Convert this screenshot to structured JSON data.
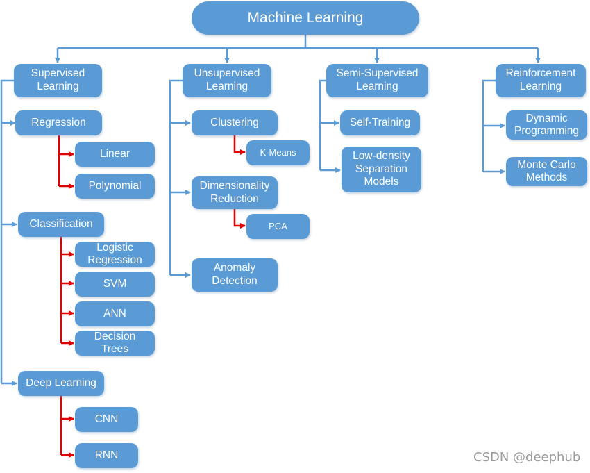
{
  "diagram": {
    "title": "Machine Learning",
    "colors": {
      "box": "#5b9bd5",
      "blue_connector": "#5b9bd5",
      "red_connector": "#e00000",
      "text": "#ffffff",
      "watermark": "#9a9a9a"
    },
    "categories": [
      {
        "label": "Supervised\nLearning",
        "children": [
          {
            "label": "Regression",
            "children": [
              "Linear",
              "Polynomial"
            ]
          },
          {
            "label": "Classification",
            "children": [
              "Logistic\nRegression",
              "SVM",
              "ANN",
              "Decision\nTrees"
            ]
          },
          {
            "label": "Deep Learning",
            "children": [
              "CNN",
              "RNN"
            ]
          }
        ]
      },
      {
        "label": "Unsupervised\nLearning",
        "children": [
          {
            "label": "Clustering",
            "children": [
              "K-Means"
            ]
          },
          {
            "label": "Dimensionality\nReduction",
            "children": [
              "PCA"
            ]
          },
          {
            "label": "Anomaly\nDetection",
            "children": []
          }
        ]
      },
      {
        "label": "Semi-Supervised\nLearning",
        "children": [
          {
            "label": "Self-Training",
            "children": []
          },
          {
            "label": "Low-density\nSeparation\nModels",
            "children": []
          }
        ]
      },
      {
        "label": "Reinforcement\nLearning",
        "children": [
          {
            "label": "Dynamic\nProgramming",
            "children": []
          },
          {
            "label": "Monte Carlo\nMethods",
            "children": []
          }
        ]
      }
    ]
  },
  "watermark": "CSDN @deephub"
}
